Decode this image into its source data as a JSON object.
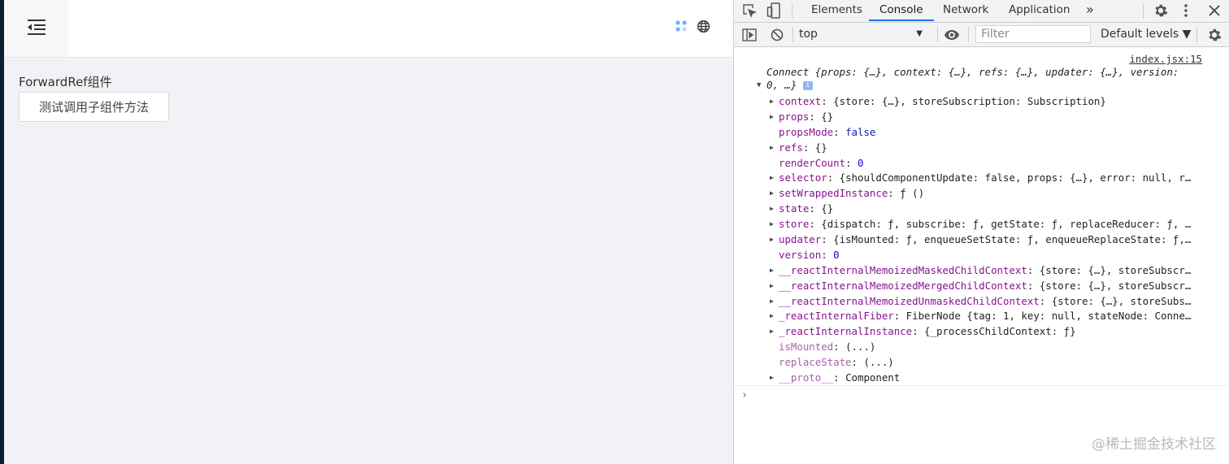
{
  "app": {
    "component_title": "ForwardRef组件",
    "test_button_label": "测试调用子组件方法"
  },
  "devtools": {
    "tabs": [
      "Elements",
      "Console",
      "Network",
      "Application"
    ],
    "active_tab": "Console",
    "more_tabs": "»",
    "context": "top",
    "filter_placeholder": "Filter",
    "levels": "Default levels ▼",
    "accent_color": "#1a73e8"
  },
  "console": {
    "source_link": "index.jsx:15",
    "object_header_line1": "Connect {props: {…}, context: {…}, refs: {…}, updater: {…}, version:",
    "object_header_line2": "0, …}",
    "info_badge": "i",
    "properties": [
      {
        "expandable": true,
        "key": "context",
        "value": "{store: {…}, storeSubscription: Subscription}",
        "type": "obj"
      },
      {
        "expandable": true,
        "key": "props",
        "value": "{}",
        "type": "obj"
      },
      {
        "expandable": false,
        "key": "propsMode",
        "value": "false",
        "type": "bool"
      },
      {
        "expandable": true,
        "key": "refs",
        "value": "{}",
        "type": "obj"
      },
      {
        "expandable": false,
        "key": "renderCount",
        "value": "0",
        "type": "num"
      },
      {
        "expandable": true,
        "key": "selector",
        "value": "{shouldComponentUpdate: false, props: {…}, error: null, r…",
        "type": "obj"
      },
      {
        "expandable": true,
        "key": "setWrappedInstance",
        "value": "ƒ ()",
        "type": "obj"
      },
      {
        "expandable": true,
        "key": "state",
        "value": "{}",
        "type": "obj"
      },
      {
        "expandable": true,
        "key": "store",
        "value": "{dispatch: ƒ, subscribe: ƒ, getState: ƒ, replaceReducer: ƒ, …",
        "type": "obj"
      },
      {
        "expandable": true,
        "key": "updater",
        "value": "{isMounted: ƒ, enqueueSetState: ƒ, enqueueReplaceState: ƒ,…",
        "type": "obj"
      },
      {
        "expandable": false,
        "key": "version",
        "value": "0",
        "type": "num"
      },
      {
        "expandable": true,
        "key": "__reactInternalMemoizedMaskedChildContext",
        "value": "{store: {…}, storeSubscr…",
        "type": "obj"
      },
      {
        "expandable": true,
        "key": "__reactInternalMemoizedMergedChildContext",
        "value": "{store: {…}, storeSubscr…",
        "type": "obj"
      },
      {
        "expandable": true,
        "key": "__reactInternalMemoizedUnmaskedChildContext",
        "value": "{store: {…}, storeSubs…",
        "type": "obj"
      },
      {
        "expandable": true,
        "key": "_reactInternalFiber",
        "value": "FiberNode {tag: 1, key: null, stateNode: Conne…",
        "type": "obj"
      },
      {
        "expandable": true,
        "key": "_reactInternalInstance",
        "value": "{_processChildContext: ƒ}",
        "type": "obj"
      },
      {
        "expandable": false,
        "key": "isMounted",
        "value": "(...)",
        "type": "dim"
      },
      {
        "expandable": false,
        "key": "replaceState",
        "value": "(...)",
        "type": "dim"
      },
      {
        "expandable": true,
        "key": "__proto__",
        "value": "Component",
        "type": "dim"
      }
    ],
    "prompt": "›"
  },
  "watermark": "@稀土掘金技术社区",
  "icons": [
    "menu-fold-icon",
    "apps-icon",
    "globe-icon",
    "inspect-element-icon",
    "device-toolbar-icon",
    "settings-icon",
    "more-vert-icon",
    "close-icon",
    "sidebar-toggle-icon",
    "clear-console-icon",
    "eye-icon",
    "console-settings-icon"
  ]
}
